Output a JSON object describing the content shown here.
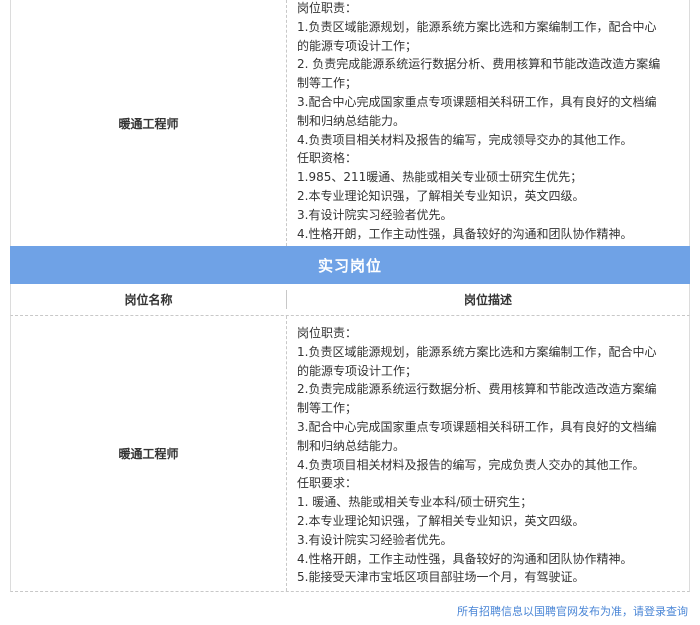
{
  "section_top": {
    "position_name": "暖通工程师",
    "lines": [
      "岗位职责：",
      "1.负责区域能源规划，能源系统方案比选和方案编制工作，配合中心",
      "的能源专项设计工作；",
      "2. 负责完成能源系统运行数据分析、费用核算和节能改造改造方案编",
      "制等工作；",
      "3.配合中心完成国家重点专项课题相关科研工作，具有良好的文档编",
      "制和归纳总结能力。",
      "4.负责项目相关材料及报告的编写，完成领导交办的其他工作。",
      "任职资格：",
      "1.985、211暖通、热能或相关专业硕士研究生优先；",
      "2.本专业理论知识强，了解相关专业知识，英文四级。",
      "3.有设计院实习经验者优先。",
      "4.性格开朗，工作主动性强，具备较好的沟通和团队协作精神。"
    ]
  },
  "intern_section": {
    "title": "实习岗位",
    "header_name": "岗位名称",
    "header_desc": "岗位描述",
    "position_name": "暖通工程师",
    "lines": [
      "岗位职责：",
      "1.负责区域能源规划，能源系统方案比选和方案编制工作，配合中心",
      "的能源专项设计工作；",
      "2.负责完成能源系统运行数据分析、费用核算和节能改造改造方案编",
      "制等工作；",
      "3.配合中心完成国家重点专项课题相关科研工作，具有良好的文档编",
      "制和归纳总结能力。",
      "4.负责项目相关材料及报告的编写，完成负责人交办的其他工作。",
      "任职要求：",
      "1. 暖通、热能或相关专业本科/硕士研究生；",
      "2.本专业理论知识强，了解相关专业知识，英文四级。",
      "3.有设计院实习经验者优先。",
      "4.性格开朗，工作主动性强，具备较好的沟通和团队协作精神。",
      "5.能接受天津市宝坻区项目部驻场一个月，有驾驶证。"
    ]
  },
  "footer": {
    "note": "所有招聘信息以国聘官网发布为准，请登录查询"
  }
}
